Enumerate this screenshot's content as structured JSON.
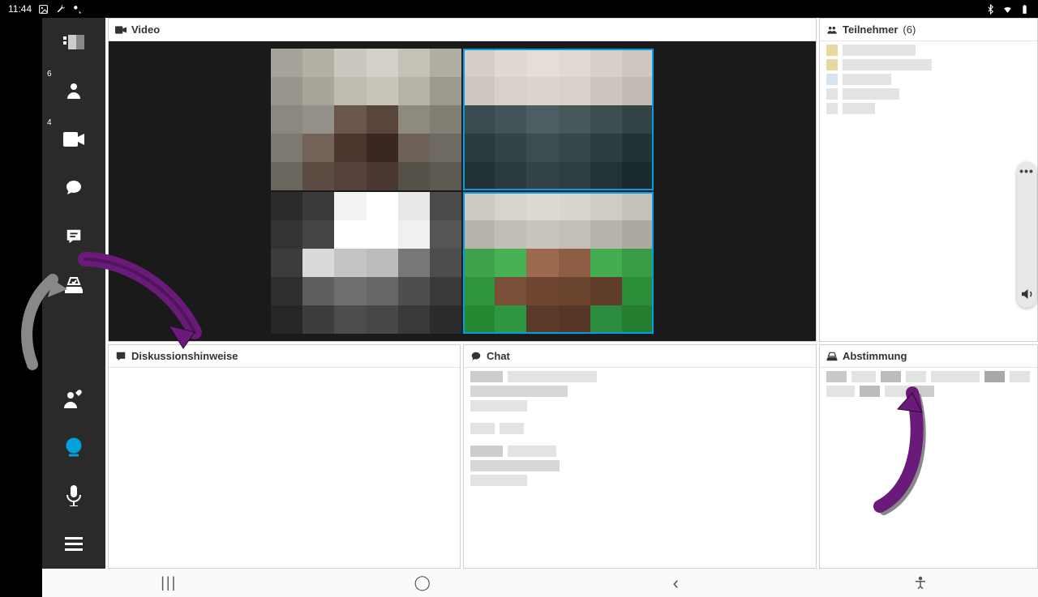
{
  "statusbar": {
    "time": "11:44"
  },
  "sidebar": {
    "participants_badge": "6",
    "videos_badge": "4"
  },
  "panels": {
    "video": {
      "title": "Video"
    },
    "participants": {
      "title": "Teilnehmer",
      "count": "(6)"
    },
    "discussion": {
      "title": "Diskussionshinweise"
    },
    "chat": {
      "title": "Chat"
    },
    "voting": {
      "title": "Abstimmung"
    }
  },
  "nav": {
    "recents": "|||",
    "home": "◯",
    "back": "‹"
  }
}
